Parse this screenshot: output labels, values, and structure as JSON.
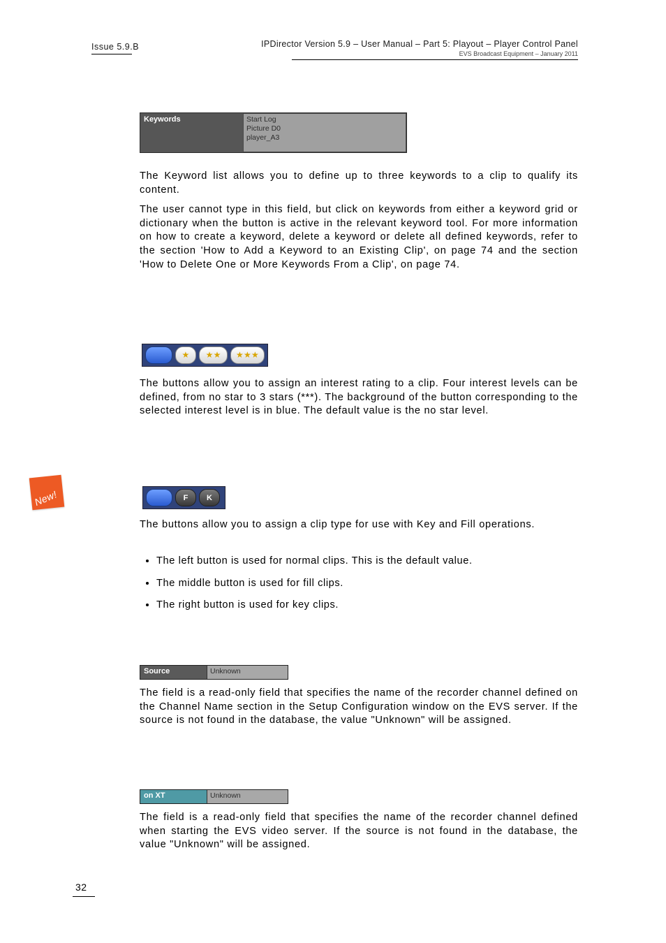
{
  "header": {
    "issue": "Issue 5.9.B",
    "title": "IPDirector Version 5.9 – User Manual – Part 5: Playout – Player Control Panel",
    "subtitle": "EVS Broadcast Equipment – January 2011"
  },
  "keywords_panel": {
    "label": "Keywords",
    "values": [
      "Start Log",
      "Picture D0",
      "player_A3"
    ]
  },
  "para_keywords_1": "The Keyword list allows you to define up to three keywords to a clip to qualify its content.",
  "para_keywords_2": "The user cannot type in this field, but click on keywords from either a keyword grid or dictionary when the        button is active in the relevant keyword tool. For more information on how to create a keyword, delete a keyword or delete all defined keywords, refer to the section 'How to Add a Keyword to an Existing Clip', on page 74 and the section 'How to Delete One or More Keywords From a Clip', on page 74.",
  "para_interest": "The                 buttons allow you to assign an interest rating to a clip. Four interest levels can be defined, from no star to 3 stars (***). The background of the button corresponding to the selected interest level is in blue. The default value is the no star level.",
  "clip_type": {
    "intro": "The           buttons allow you to assign a clip type for use with Key and Fill operations.",
    "bullets": [
      "The left button is used for normal clips. This is the default value.",
      "The middle button is used for fill clips.",
      "The right button is used for key clips."
    ],
    "f": "F",
    "k": "K"
  },
  "source_panel": {
    "label": "Source",
    "value": "Unknown"
  },
  "para_source": "The         field is a read-only field that specifies the name of the recorder channel defined on the Channel Name section in the Setup Configuration window on the EVS server. If the source is not found in the database, the value \"Unknown\" will be assigned.",
  "onxt_panel": {
    "label": "on XT",
    "value": "Unknown"
  },
  "para_onxt": "The         field is a read-only field that specifies the name of the recorder channel defined when starting the EVS video server. If the source is not found in the database, the value \"Unknown\" will be assigned.",
  "new_badge": "New!",
  "page_number": "32"
}
